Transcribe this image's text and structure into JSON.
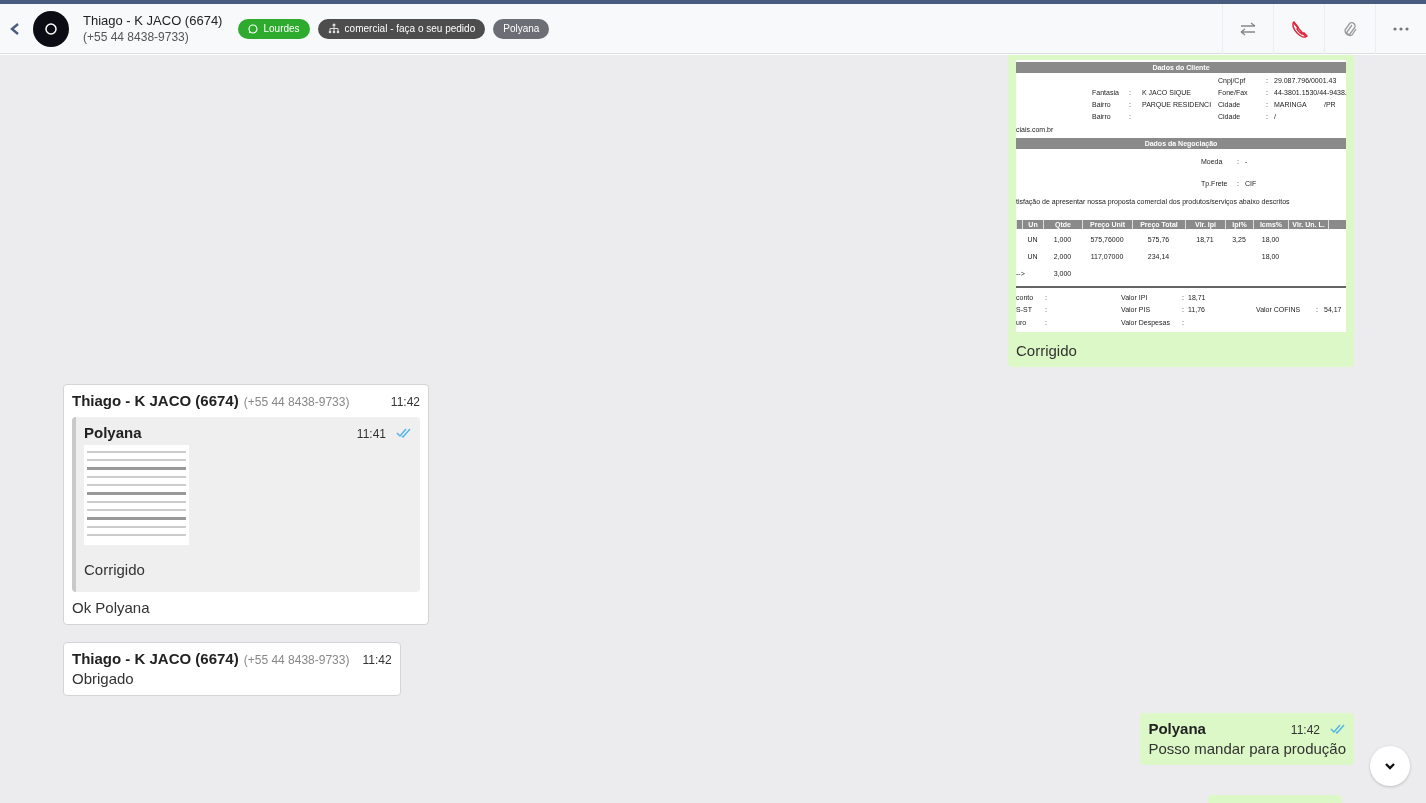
{
  "header": {
    "name": "Thiago - K JACO (6674)",
    "phone": "(+55 44 8438-9733)",
    "tags": [
      {
        "kind": "whatsapp",
        "label": "Lourdes",
        "color": "#2eab2e"
      },
      {
        "kind": "department",
        "label": "comercial - faça o seu pedido",
        "color": "#4d4d4d"
      },
      {
        "kind": "plain",
        "label": "Polyana",
        "color": "#6b6e75"
      }
    ]
  },
  "messages": [
    {
      "kind": "document",
      "outgoing": true,
      "caption": "Corrigido",
      "document": {
        "sections": [
          {
            "kind": "band",
            "title": "Dados do Cliente"
          },
          {
            "kind": "fields",
            "right": [
              "Cnpj/Cpf",
              ":",
              "29.087.796/0001.43"
            ]
          },
          {
            "kind": "fields",
            "left": [
              "Fantasia",
              ":",
              "K JACO SIQUE"
            ],
            "right": [
              "Fone/Fax",
              ":",
              "44-3801.1530/44-9438."
            ]
          },
          {
            "kind": "fields",
            "left": [
              "Bairro",
              ":",
              "PARQUE RESIDENCI"
            ],
            "right": [
              "Cidade",
              ":",
              "MARINGA",
              "/PR"
            ]
          },
          {
            "kind": "fields",
            "left": [
              "Bairro",
              ":"
            ],
            "right": [
              "Cidade",
              ":",
              "/"
            ]
          },
          {
            "kind": "line",
            "text": "ciais.com.br"
          },
          {
            "kind": "band",
            "title": "Dados da Negociação"
          },
          {
            "kind": "center",
            "cells": [
              "Moeda",
              ":",
              "-"
            ]
          },
          {
            "kind": "center",
            "cells": [
              "Tp.Frete",
              ":",
              "CIF"
            ]
          },
          {
            "kind": "line",
            "text": "tisfação de apresentar nossa proposta comercial dos produtos/serviços abaixo descritos"
          },
          {
            "kind": "table",
            "columns": [
              "",
              "Un",
              "Qtde",
              "Preço Unit",
              "Preço Total",
              "Vlr. Ipi",
              "Ipi%",
              "Icms%",
              "Vlr. Un. L."
            ],
            "rows": [
              [
                null,
                "UN",
                "1,000",
                "575,76000",
                "575,76",
                "18,71",
                "3,25",
                "18,00"
              ],
              [
                null,
                "UN",
                "2,000",
                "117,07000",
                "234,14",
                null,
                null,
                "18,00"
              ],
              [
                "-->",
                null,
                "3,000"
              ]
            ]
          },
          {
            "kind": "totals",
            "rows": [
              [
                "conto",
                ":",
                "Valor IPI",
                ":",
                "18,71"
              ],
              [
                "S-ST",
                ":",
                "Valor PIS",
                ":",
                "11,76",
                "Valor COFINS",
                ":",
                "54,17"
              ],
              [
                "uro",
                ":",
                "Valor Despesas",
                ":"
              ]
            ]
          }
        ]
      }
    },
    {
      "kind": "reply",
      "outgoing": false,
      "sender": "Thiago - K JACO (6674)",
      "phone": "(+55 44 8438-9733)",
      "time": "11:42",
      "quote": {
        "sender": "Polyana",
        "time": "11:41",
        "read": true,
        "caption": "Corrigido"
      },
      "text": "Ok Polyana"
    },
    {
      "kind": "text",
      "outgoing": false,
      "sender": "Thiago - K JACO (6674)",
      "phone": "(+55 44 8438-9733)",
      "time": "11:42",
      "text": "Obrigado"
    },
    {
      "kind": "text",
      "outgoing": true,
      "sender": "Polyana",
      "time": "11:42",
      "read": true,
      "text": "Posso mandar para produção"
    },
    {
      "kind": "clipped",
      "outgoing": true
    }
  ]
}
